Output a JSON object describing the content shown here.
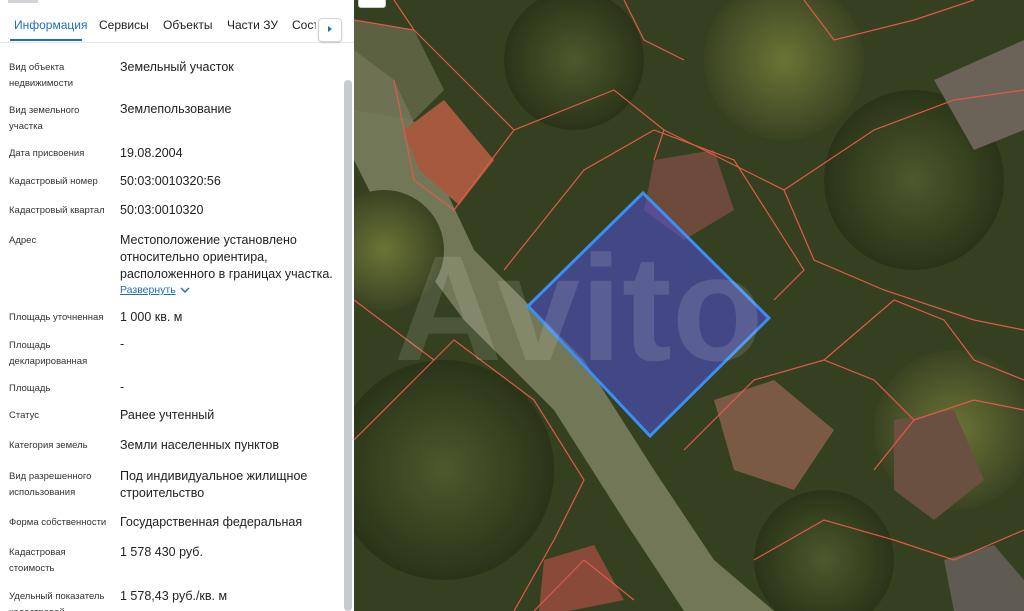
{
  "tabs": [
    {
      "label": "Информация",
      "active": true
    },
    {
      "label": "Сервисы",
      "active": false
    },
    {
      "label": "Объекты",
      "active": false
    },
    {
      "label": "Части ЗУ",
      "active": false
    },
    {
      "label": "Состав ЕЗП",
      "active": false
    }
  ],
  "info": {
    "type_label": "Вид объекта недвижимости",
    "type_value": "Земельный участок",
    "land_type_label": "Вид земельного участка",
    "land_type_value": "Землепользование",
    "date_label": "Дата присвоения",
    "date_value": "19.08.2004",
    "cad_num_label": "Кадастровый номер",
    "cad_num_value": "50:03:0010320:56",
    "cad_quarter_label": "Кадастровый квартал",
    "cad_quarter_value": "50:03:0010320",
    "address_label": "Адрес",
    "address_value": "Местоположение установлено относительно ориентира, расположенного в границах участка.",
    "expand_label": "Развернуть",
    "area_spec_label": "Площадь уточненная",
    "area_spec_value": "1 000 кв. м",
    "area_decl_label": "Площадь декларированная",
    "area_decl_value": "-",
    "area_label": "Площадь",
    "area_value": "-",
    "status_label": "Статус",
    "status_value": "Ранее учтенный",
    "category_label": "Категория земель",
    "category_value": "Земли населенных пунктов",
    "use_label": "Вид разрешенного использования",
    "use_value": "Под индивидуальное жилищное строительство",
    "ownership_label": "Форма собственности",
    "ownership_value": "Государственная федеральная",
    "cad_cost_label": "Кадастровая стоимость",
    "cad_cost_value": "1 578 430 руб.",
    "unit_cost_label": "Удельный показатель кадастровой",
    "unit_cost_value": "1 578,43 руб./кв. м"
  },
  "map": {
    "watermark": "Avito",
    "parcel_color": "#3a6fe0",
    "boundary_color": "#e05a4a"
  }
}
